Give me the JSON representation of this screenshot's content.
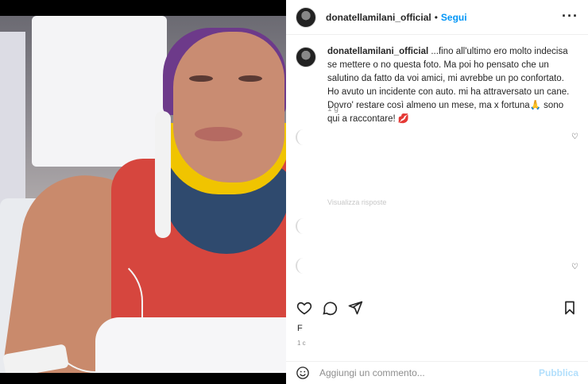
{
  "post": {
    "username": "donatellamilani_official",
    "follow_label": "Segui",
    "header_separator": "•",
    "more_icon": "more-horizontal-icon",
    "caption_username": "donatellamilani_official",
    "caption_text": " ...fino all'ultimo ero molto indecisa se mettere o no questa foto. Ma poi ho pensato che un salutino da fatto da voi amici, mi avrebbe un po confortato. Ho avuto un incidente con auto. mi ha attraversato un cane. Dovro' restare così almeno un mese, ma x fortuna🙏 sono qui a raccontare! 💋",
    "caption_age": "1 g",
    "faded_reply": "Visualizza risposte"
  },
  "actions": {
    "like_icon": "heart-icon",
    "comment_icon": "comment-icon",
    "share_icon": "send-icon",
    "save_icon": "bookmark-icon"
  },
  "likes_partial": "F",
  "date_partial": "1 c",
  "add_comment": {
    "placeholder": "Aggiungi un commento...",
    "publish_label": "Pubblica",
    "emoji_icon": "smiley-icon"
  },
  "colors": {
    "accent": "#0095f6",
    "publish_disabled": "#b2dffc",
    "text": "#262626",
    "muted": "#8e8e8e"
  }
}
